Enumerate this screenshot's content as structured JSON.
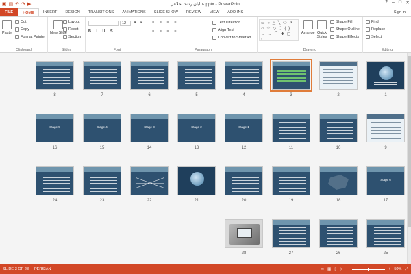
{
  "window": {
    "title": "عنایان رشد اخلاقی.pptx - PowerPoint",
    "controls": [
      "?",
      "–",
      "□",
      "✕"
    ]
  },
  "quick_access": [
    "save-icon",
    "undo-icon",
    "redo-icon",
    "start-icon"
  ],
  "tabs": [
    "FILE",
    "HOME",
    "INSERT",
    "DESIGN",
    "TRANSITIONS",
    "ANIMATIONS",
    "SLIDE SHOW",
    "REVIEW",
    "VIEW",
    "ADD-INS"
  ],
  "active_tab": "HOME",
  "signin": "Sign in",
  "ribbon": {
    "clipboard": {
      "paste": "Paste",
      "cut": "Cut",
      "copy": "Copy",
      "format_painter": "Format Painter",
      "label": "Clipboard"
    },
    "slides": {
      "new_slide": "New Slide",
      "layout": "Layout",
      "reset": "Reset",
      "section": "Section",
      "label": "Slides"
    },
    "font": {
      "size": "12",
      "label": "Font"
    },
    "paragraph": {
      "text_direction": "Text Direction",
      "align_text": "Align Text",
      "convert": "Convert to SmartArt",
      "label": "Paragraph"
    },
    "drawing": {
      "arrange": "Arrange",
      "quick_styles": "Quick Styles",
      "shape_fill": "Shape Fill",
      "shape_outline": "Shape Outline",
      "shape_effects": "Shape Effects",
      "label": "Drawing"
    },
    "editing": {
      "find": "Find",
      "replace": "Replace",
      "select": "Select",
      "label": "Editing"
    }
  },
  "sorter": {
    "selected": "3",
    "slides": [
      {
        "num": "1",
        "theme": "globe"
      },
      {
        "num": "2",
        "theme": "light"
      },
      {
        "num": "3",
        "theme": "green"
      },
      {
        "num": "4",
        "theme": "bullets"
      },
      {
        "num": "5",
        "theme": "bullets"
      },
      {
        "num": "6",
        "theme": "bullets"
      },
      {
        "num": "7",
        "theme": "bullets"
      },
      {
        "num": "8",
        "theme": "bullets"
      },
      {
        "num": "9",
        "theme": "light"
      },
      {
        "num": "10",
        "theme": "bullets"
      },
      {
        "num": "11",
        "theme": "bullets"
      },
      {
        "num": "12",
        "theme": "title",
        "title": "Stage 1"
      },
      {
        "num": "13",
        "theme": "title",
        "title": "Stage 2"
      },
      {
        "num": "14",
        "theme": "title",
        "title": "Stage 3"
      },
      {
        "num": "15",
        "theme": "title",
        "title": "Stage 4"
      },
      {
        "num": "16",
        "theme": "title",
        "title": "Stage 5"
      },
      {
        "num": "17",
        "theme": "title",
        "title": "Stage 6"
      },
      {
        "num": "18",
        "theme": "map"
      },
      {
        "num": "19",
        "theme": "bullets"
      },
      {
        "num": "20",
        "theme": "bullets"
      },
      {
        "num": "21",
        "theme": "globe"
      },
      {
        "num": "22",
        "theme": "diag"
      },
      {
        "num": "23",
        "theme": "bullets"
      },
      {
        "num": "24",
        "theme": "bullets"
      },
      {
        "num": "25",
        "theme": "bullets"
      },
      {
        "num": "26",
        "theme": "bullets"
      },
      {
        "num": "27",
        "theme": "bullets"
      },
      {
        "num": "28",
        "theme": "photo"
      }
    ]
  },
  "status": {
    "slide_info": "SLIDE 3 OF 28",
    "language": "PERSIAN",
    "zoom": "50%"
  }
}
